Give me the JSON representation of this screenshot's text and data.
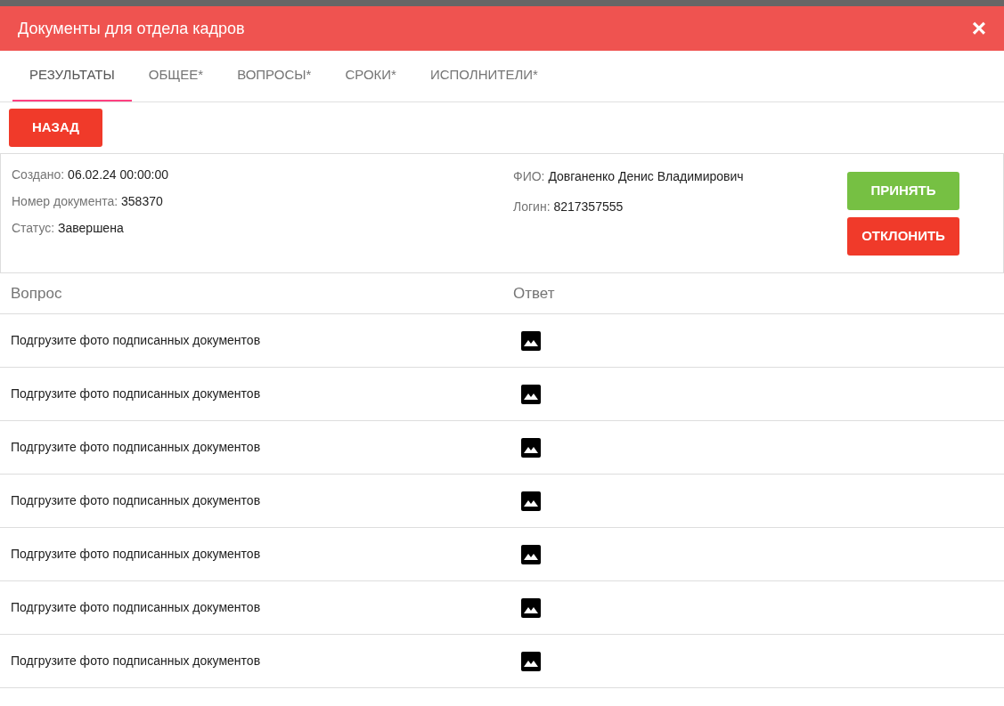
{
  "modal": {
    "title": "Документы для отдела кадров",
    "close": "×"
  },
  "tabs": [
    {
      "label": "РЕЗУЛЬТАТЫ",
      "selected": true
    },
    {
      "label": "ОБЩЕЕ*",
      "selected": false
    },
    {
      "label": "ВОПРОСЫ*",
      "selected": false
    },
    {
      "label": "СРОКИ*",
      "selected": false
    },
    {
      "label": "ИСПОЛНИТЕЛИ*",
      "selected": false
    }
  ],
  "back_button": "НАЗАД",
  "info_left": [
    {
      "label": "Создано:",
      "value": "06.02.24 00:00:00"
    },
    {
      "label": "Номер документа:",
      "value": "358370"
    },
    {
      "label": "Статус:",
      "value": "Завершена"
    }
  ],
  "info_right": [
    {
      "label": "ФИО:",
      "value": "Довганенко Денис Владимирович"
    },
    {
      "label": "Логин:",
      "value": "8217357555"
    }
  ],
  "actions": [
    {
      "label": "ПРИНЯТЬ",
      "kind": "accept"
    },
    {
      "label": "ОТКЛОНИТЬ",
      "kind": "reject"
    }
  ],
  "table": {
    "columns": [
      "Вопрос",
      "Ответ"
    ],
    "rows": [
      {
        "question": "Подгрузите фото подписанных документов",
        "kind": "image"
      },
      {
        "question": "Подгрузите фото подписанных документов",
        "kind": "image"
      },
      {
        "question": "Подгрузите фото подписанных документов",
        "kind": "image"
      },
      {
        "question": "Подгрузите фото подписанных документов",
        "kind": "image"
      },
      {
        "question": "Подгрузите фото подписанных документов",
        "kind": "image"
      },
      {
        "question": "Подгрузите фото подписанных документов",
        "kind": "image"
      },
      {
        "question": "Подгрузите фото подписанных документов",
        "kind": "image"
      }
    ]
  }
}
